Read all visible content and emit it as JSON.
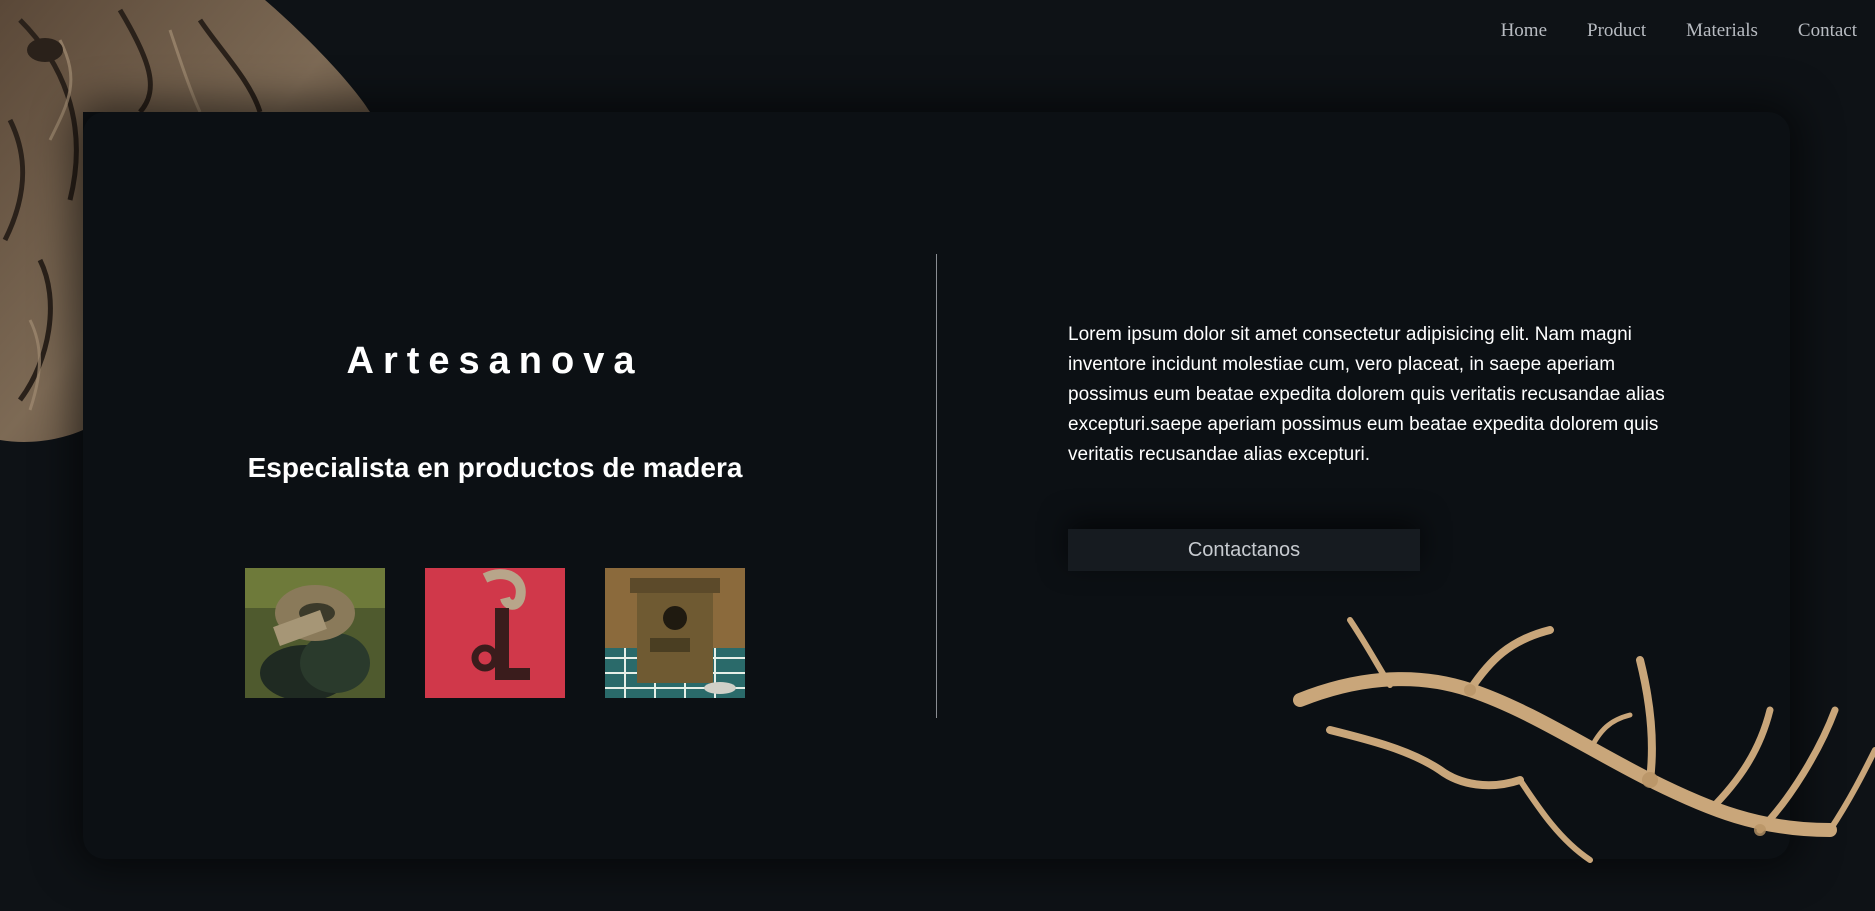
{
  "nav": {
    "items": [
      {
        "label": "Home"
      },
      {
        "label": "Product"
      },
      {
        "label": "Materials"
      },
      {
        "label": "Contact"
      }
    ]
  },
  "hero": {
    "brand": "Artesanova",
    "tagline": "Especialista en productos de madera",
    "description": "Lorem ipsum dolor sit amet consectetur adipisicing elit. Nam magni inventore incidunt molestiae cum, vero placeat, in saepe aperiam possimus eum beatae expedita dolorem quis veritatis recusandae alias excepturi.saepe aperiam possimus eum beatae expedita dolorem quis veritatis recusandae alias excepturi.",
    "cta_label": "Contactanos"
  },
  "colors": {
    "background": "#0e1216",
    "card": "#0c1014",
    "wood": "#c9a67a"
  }
}
